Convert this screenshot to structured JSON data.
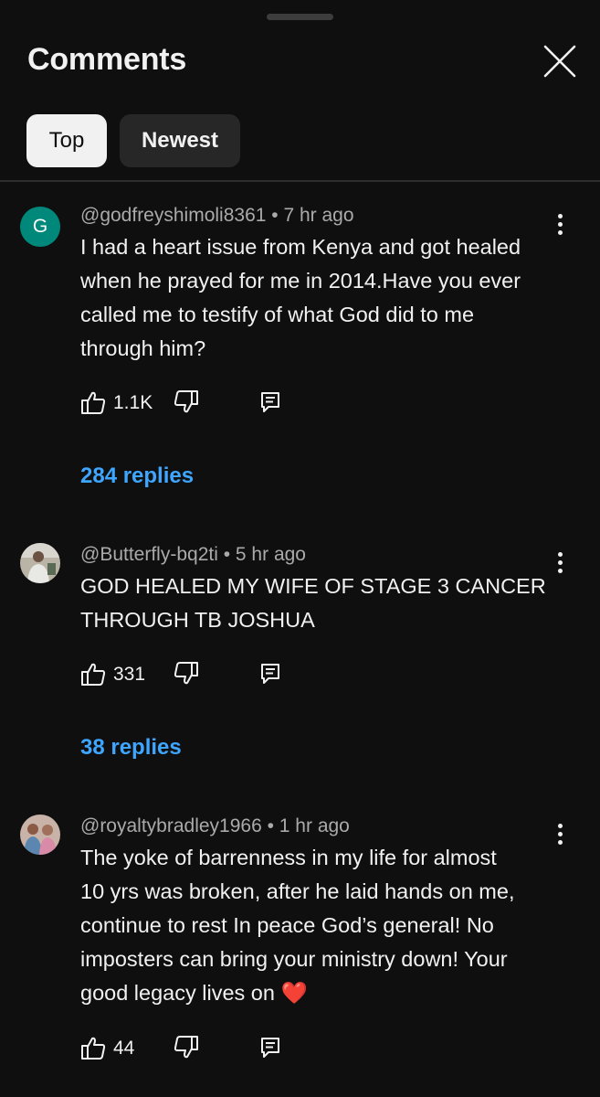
{
  "header": {
    "title": "Comments"
  },
  "tabs": [
    {
      "label": "Top",
      "selected": true
    },
    {
      "label": "Newest",
      "selected": false
    }
  ],
  "comments": [
    {
      "avatar_letter": "G",
      "avatar_color": "#00897b",
      "author": "@godfreyshimoli8361",
      "time": "7 hr ago",
      "text_lines": [
        "I had a heart issue from Kenya and got healed",
        "when he prayed for me in 2014.Have you ever",
        "called me to testify of what God did to me",
        "through him?"
      ],
      "likes": "1.1K",
      "replies": "284 replies"
    },
    {
      "author": "@Butterfly-bq2ti",
      "time": "5 hr ago",
      "text_lines": [
        "GOD HEALED MY WIFE OF STAGE 3 CANCER",
        "THROUGH TB JOSHUA"
      ],
      "likes": "331",
      "replies": "38 replies"
    },
    {
      "author": "@royaltybradley1966",
      "time": "1 hr ago",
      "text_lines": [
        "The yoke of barrenness in my life for almost",
        "10 yrs was broken, after he laid hands on me,",
        "continue to rest In peace God’s general! No",
        "imposters can bring your ministry down! Your",
        "good legacy lives on"
      ],
      "emoji": "❤️",
      "likes": "44"
    }
  ],
  "separator": " • ",
  "colors": {
    "background": "#0f0f0f",
    "link_blue": "#3ea6ff",
    "meta_gray": "#aaaaaa"
  }
}
